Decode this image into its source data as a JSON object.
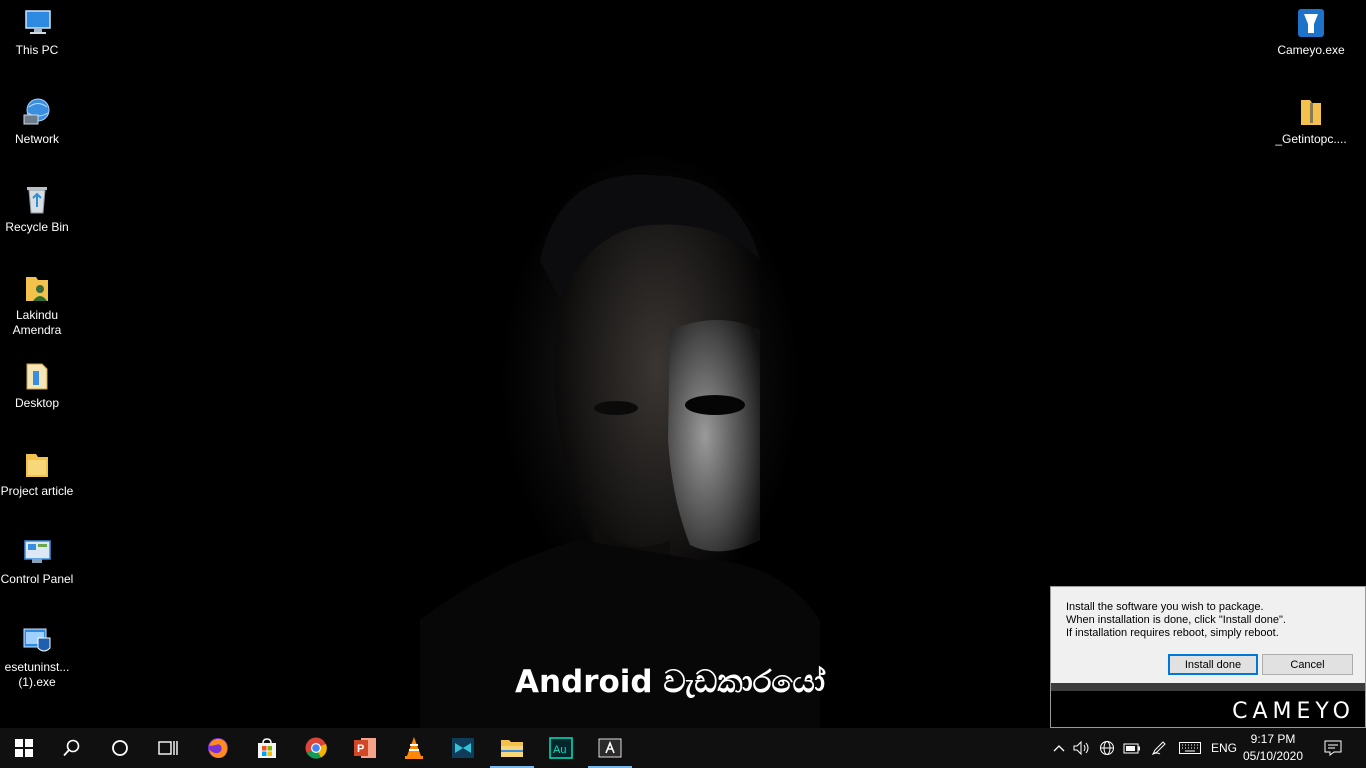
{
  "desktop": {
    "left_icons": [
      {
        "label": "This PC",
        "icon": "computer-icon"
      },
      {
        "label": "Network",
        "icon": "network-icon"
      },
      {
        "label": "Recycle Bin",
        "icon": "recycle-bin-icon"
      },
      {
        "label": "Lakindu Amendra",
        "icon": "user-folder-icon"
      },
      {
        "label": "Desktop",
        "icon": "desktop-folder-icon"
      },
      {
        "label": "Project article",
        "icon": "folder-icon"
      },
      {
        "label": "Control Panel",
        "icon": "control-panel-icon"
      },
      {
        "label": "esetuninst...(1).exe",
        "icon": "installer-icon"
      }
    ],
    "right_icons": [
      {
        "label": "Cameyo.exe",
        "icon": "cameyo-icon"
      },
      {
        "label": "_Getintopc....",
        "icon": "zip-folder-icon"
      }
    ],
    "wallpaper_caption": "Android වැඩකාරයෝ"
  },
  "cameyo_dialog": {
    "line1": "Install the software you wish to package.",
    "line2": "When installation is done, click \"Install done\".",
    "line3": "If installation requires reboot, simply reboot.",
    "install_done_label": "Install done",
    "cancel_label": "Cancel",
    "brand": "CAMEYO"
  },
  "taskbar": {
    "items": [
      "start-icon",
      "search-icon",
      "cortana-icon",
      "task-view-icon",
      "firefox-icon",
      "store-icon",
      "chrome-icon",
      "powerpoint-icon",
      "vlc-icon",
      "video-editor-icon",
      "file-explorer-icon",
      "audition-icon",
      "adobe-app-icon"
    ],
    "tray": {
      "language": "ENG",
      "time": "9:17 PM",
      "date": "05/10/2020"
    },
    "colors": {
      "accent": "#76b9ed",
      "background": "#101010"
    }
  }
}
